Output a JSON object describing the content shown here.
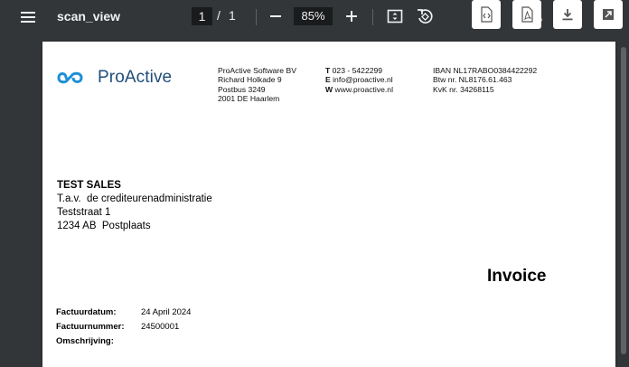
{
  "toolbar": {
    "title": "scan_view",
    "current_page": "1",
    "page_separator": "/",
    "total_pages": "1",
    "zoom": "85%",
    "separator_comma": ","
  },
  "document": {
    "logo_text": "ProActive",
    "company": {
      "name": "ProActive Software BV",
      "street": "Richard Holkade 9",
      "pobox": "Postbus 3249",
      "city": "2001 DE Haarlem"
    },
    "contact": {
      "phone_label": "T",
      "phone": "023 - 5422299",
      "email_label": "E",
      "email": "info@proactive.nl",
      "web_label": "W",
      "web": "www.proactive.nl"
    },
    "registration": {
      "iban": "IBAN NL17RABO0384422292",
      "btw": "Btw nr. NL8176.61.463",
      "kvk": "KvK nr. 34268115"
    },
    "recipient": {
      "name": "TEST SALES",
      "attn": "T.a.v.  de crediteurenadministratie",
      "street": "Teststraat 1",
      "city": "1234 AB  Postplaats"
    },
    "invoice_title": "Invoice",
    "fields": [
      {
        "label": "Factuurdatum:",
        "value": "24 April 2024"
      },
      {
        "label": "Factuurnummer:",
        "value": "24500001"
      },
      {
        "label": "Omschrijving:",
        "value": ""
      }
    ]
  },
  "colors": {
    "toolbar_bg": "#323639",
    "logo_blue": "#1f4e79",
    "logo_icon": "#1d8fd6"
  }
}
